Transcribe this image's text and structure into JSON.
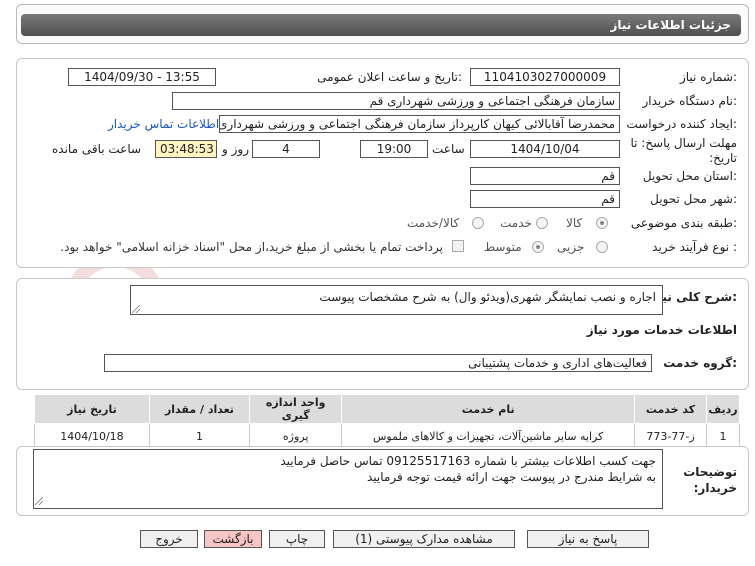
{
  "header": {
    "title": "جزئیات اطلاعات نیاز"
  },
  "form": {
    "need_number_label": "شماره نیاز:",
    "need_number": "1104103027000009",
    "announce_label": "تاریخ و ساعت اعلان عمومی:",
    "announce_value": "1404/09/30 - 13:55",
    "buyer_org_label": "نام دستگاه خریدار:",
    "buyer_org": "سازمان فرهنگی اجتماعی و ورزشی شهرداری قم",
    "creator_label": "ایجاد کننده درخواست:",
    "creator": "محمدرضا آقابالائی کیهان کارپرداز سازمان فرهنگی اجتماعی و ورزشی شهرداری",
    "contact_link": "اطلاعات تماس خریدار",
    "deadline_label": "مهلت ارسال پاسخ: تا تاریخ:",
    "deadline_date": "1404/10/04",
    "time_label": "ساعت",
    "deadline_time": "19:00",
    "days_value": "4",
    "days_label": "روز و",
    "remaining_time": "03:48:53",
    "remaining_label": "ساعت باقی مانده",
    "province_label": "استان محل تحویل:",
    "province": "قم",
    "city_label": "شهر محل تحویل:",
    "city": "قم",
    "category_label": "طبقه بندی موضوعی:",
    "category_options": [
      "کالا",
      "خدمت",
      "کالا/خدمت"
    ],
    "purchase_type_label": "نوع فرآیند خرید :",
    "purchase_options": [
      "جزیی",
      "متوسط"
    ],
    "payment_note": "پرداخت تمام یا بخشی از مبلغ خرید،از محل \"اسناد خزانه اسلامی\" خواهد بود."
  },
  "summary": {
    "label": "شرح کلی نیاز:",
    "text": "اجاره و نصب نمایشگر شهری(ویدئو وال) به شرح مشخصات پیوست"
  },
  "services": {
    "heading": "اطلاعات خدمات مورد نیاز",
    "group_label": "گروه خدمت:",
    "group_value": "فعالیت‌های اداری و خدمات پشتیبانی",
    "columns": [
      "ردیف",
      "کد خدمت",
      "نام خدمت",
      "واحد اندازه گیری",
      "تعداد / مقدار",
      "تاریخ نیاز"
    ],
    "rows": [
      [
        "1",
        "ز-77-773",
        "کرایه سایر ماشین‌آلات، تجهیزات و کالاهای ملموس",
        "پروژه",
        "1",
        "1404/10/18"
      ]
    ]
  },
  "buyer_notes": {
    "label": "توضیحات خریدار:",
    "lines": [
      "جهت کسب اطلاعات بیشتر با شماره 09125517163 تماس حاصل فرمایید",
      "به شرایط مندرج در پیوست جهت ارائه قیمت توجه فرمایید"
    ]
  },
  "buttons": {
    "reply": "پاسخ به نیاز",
    "attachments": "مشاهده مدارک پیوستی (1)",
    "print": "چاپ",
    "back": "بازگشت",
    "exit": "خروج"
  },
  "colors": {
    "header_bg": "#5e5e5e",
    "link": "#1a55c8",
    "timer_bg": "#fff6c2",
    "back_button": "#f6c6c6"
  }
}
